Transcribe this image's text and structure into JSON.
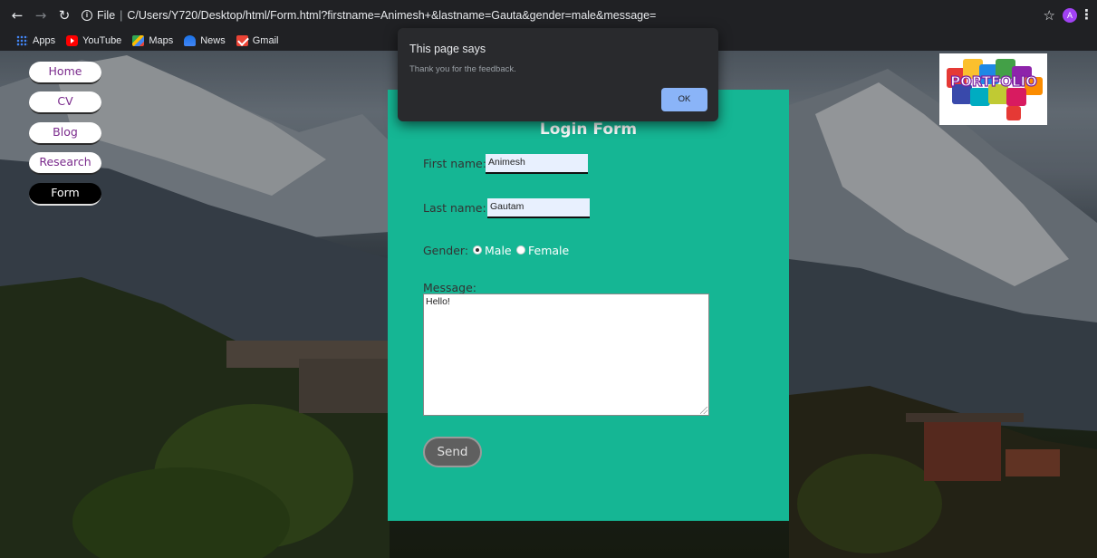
{
  "browser": {
    "url": "C/Users/Y720/Desktop/html/Form.html?firstname=Animesh+&lastname=Gauta&gender=male&message=",
    "url_scheme": "File",
    "profile_initial": "A",
    "bookmarks": [
      {
        "label": "Apps",
        "icon": "apps-icon"
      },
      {
        "label": "YouTube",
        "icon": "youtube-icon"
      },
      {
        "label": "Maps",
        "icon": "maps-icon"
      },
      {
        "label": "News",
        "icon": "news-icon"
      },
      {
        "label": "Gmail",
        "icon": "gmail-icon"
      }
    ]
  },
  "nav": {
    "items": [
      "Home",
      "CV",
      "Blog",
      "Research",
      "Form"
    ],
    "active": "Form"
  },
  "logo": {
    "text": "PORTFOLIO"
  },
  "form": {
    "title": "Login Form",
    "first_name_label": "First name:",
    "first_name_value": "Animesh",
    "last_name_label": "Last name:",
    "last_name_value": "Gautam",
    "gender_label": "Gender:",
    "gender_options": [
      "Male",
      "Female"
    ],
    "gender_selected": "Male",
    "message_label": "Message:",
    "message_value": "Hello!",
    "send_label": "Send"
  },
  "dialog": {
    "title": "This page says",
    "message": "Thank you for the feedback.",
    "ok_label": "OK"
  },
  "colors": {
    "panel": "#15b694",
    "dialog_bg": "#292a2d",
    "ok_button": "#8ab4f8",
    "nav_active": "#000000"
  }
}
